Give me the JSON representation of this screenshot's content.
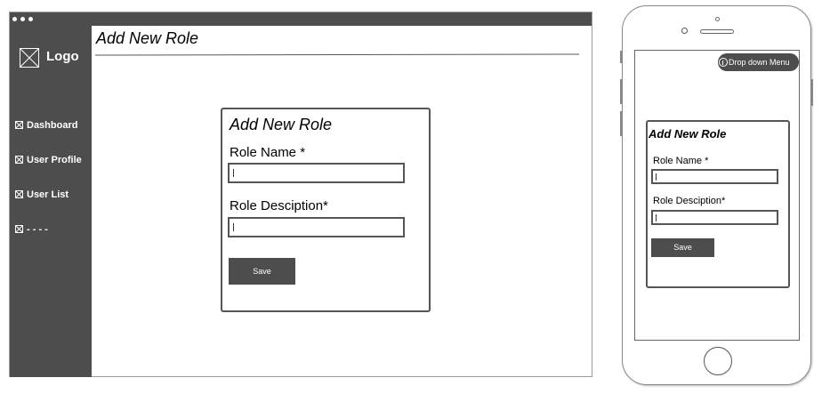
{
  "desktop": {
    "logo_text": "Logo",
    "sidebar": {
      "items": [
        {
          "label": "Dashboard"
        },
        {
          "label": "User Profile"
        },
        {
          "label": "User List"
        },
        {
          "label": "- - - -"
        }
      ]
    },
    "page_title": "Add New Role",
    "form": {
      "title": "Add New Role",
      "role_name_label": "Role Name *",
      "role_description_label": "Role Desciption*",
      "role_name_value": "",
      "role_description_value": "",
      "save_label": "Save"
    }
  },
  "mobile": {
    "dropdown_label": "Drop down Menu",
    "form": {
      "title": "Add New Role",
      "role_name_label": "Role Name *",
      "role_description_label": "Role Desciption*",
      "role_name_value": "",
      "role_description_value": "",
      "save_label": "Save"
    }
  },
  "colors": {
    "chrome_dark": "#4d4d4d",
    "border": "#555555",
    "background": "#ffffff"
  },
  "icons": [
    "logo-placeholder-icon",
    "image-placeholder-icon",
    "info-icon"
  ]
}
